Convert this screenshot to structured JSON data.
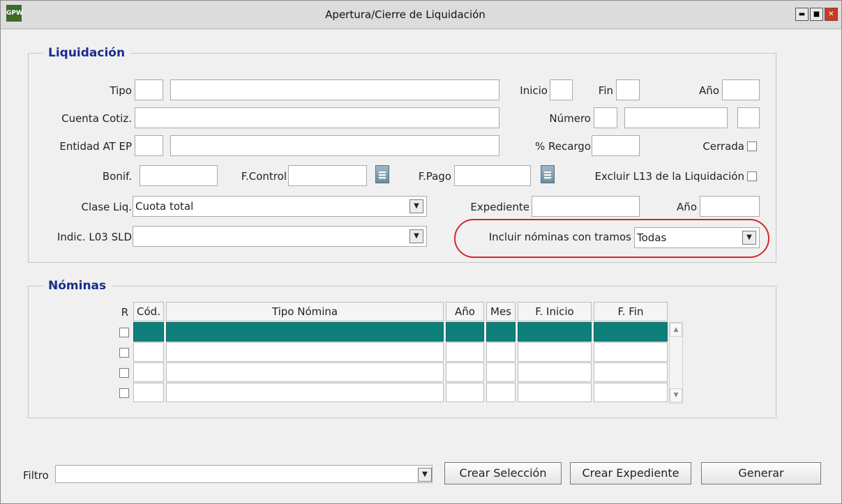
{
  "window": {
    "title": "Apertura/Cierre de Liquidación",
    "icon": "GPW",
    "controls": {
      "minimize": "▬",
      "maximize": "■",
      "close": "✕"
    }
  },
  "liquidacion": {
    "legend": "Liquidación",
    "tipo_label": "Tipo",
    "inicio_label": "Inicio",
    "fin_label": "Fin",
    "anio_label": "Año",
    "cuenta_label": "Cuenta Cotiz.",
    "numero_label": "Número",
    "entidad_label": "Entidad AT EP",
    "recargo_label": "% Recargo",
    "cerrada_label": "Cerrada",
    "bonif_label": "Bonif.",
    "fcontrol_label": "F.Control",
    "fpago_label": "F.Pago",
    "excluir_label": "Excluir L13 de la Liquidación",
    "clase_label": "Clase Liq.",
    "clase_value": "Cuota total",
    "expediente_label": "Expediente",
    "anio2_label": "Año",
    "indic_label": "Indic. L03 SLD",
    "indic_value": "",
    "incluir_label": "Incluir nóminas con tramos",
    "incluir_value": "Todas"
  },
  "nominas": {
    "legend": "Nóminas",
    "columns": [
      "R",
      "Cód.",
      "Tipo Nómina",
      "Año",
      "Mes",
      "F. Inicio",
      "F. Fin"
    ],
    "row_count": 4,
    "selected_row": 0
  },
  "footer": {
    "filtro_label": "Filtro",
    "filtro_value": "",
    "crear_seleccion": "Crear Selección",
    "crear_expediente": "Crear Expediente",
    "generar": "Generar"
  },
  "colors": {
    "legend": "#1a2d8c",
    "selected_row": "#0f7f7c",
    "highlight": "#d8252d"
  },
  "icons": {
    "dropdown": "chevron-down-icon",
    "calendar": "calendar-icon",
    "scroll_up": "scroll-up-icon",
    "scroll_down": "scroll-down-icon"
  }
}
